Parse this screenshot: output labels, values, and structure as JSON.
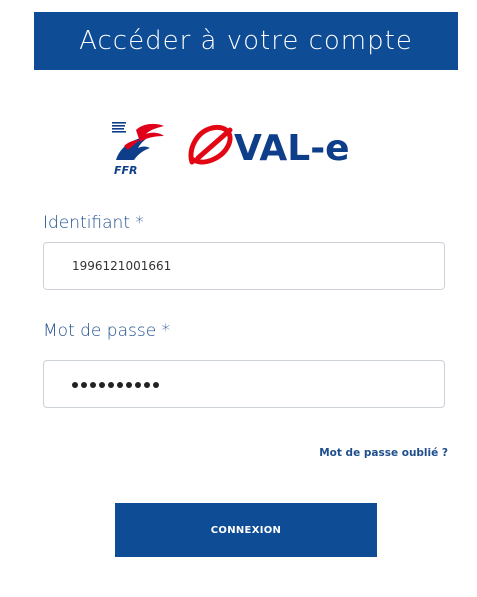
{
  "header": {
    "title": "Accéder à votre compte"
  },
  "logo": {
    "ffr_text": "FFR",
    "oval_text": "VAL-e",
    "ffr_colors": {
      "red": "#e1001a",
      "blue": "#0e3e8a"
    },
    "oval_colors": {
      "red": "#e30613",
      "navy": "#0e3e8a"
    }
  },
  "form": {
    "identifier": {
      "label": "Identifiant *",
      "value": "1996121001661"
    },
    "password": {
      "label": "Mot de passe *",
      "masked_char_count": 10
    },
    "forgot_password": "Mot de passe oublié ?",
    "submit_label": "CONNEXION"
  },
  "colors": {
    "primary": "#0e4c96",
    "label": "#1e4e8c",
    "input_border": "#cdd2d8"
  }
}
